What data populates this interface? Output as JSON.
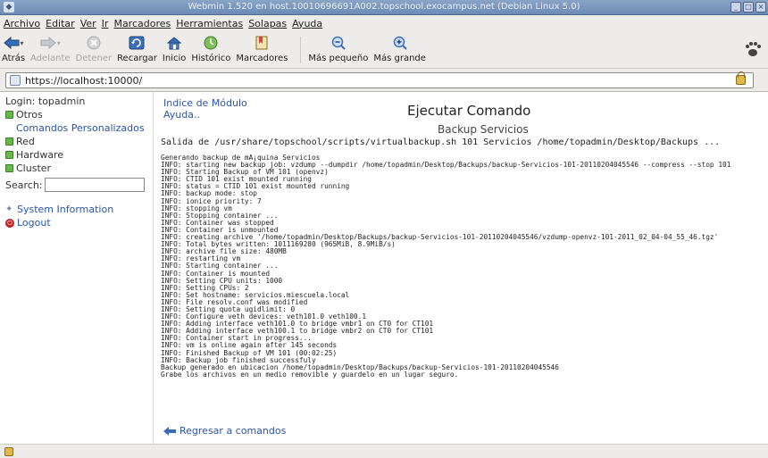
{
  "window": {
    "title": "Webmin 1.520 en host.10010696691A002.topschool.exocampus.net (Debian Linux 5.0)"
  },
  "menubar": {
    "items": [
      "Archivo",
      "Editar",
      "Ver",
      "Ir",
      "Marcadores",
      "Herramientas",
      "Solapas",
      "Ayuda"
    ]
  },
  "toolbar": {
    "back": "Atrás",
    "forward": "Adelante",
    "stop": "Detener",
    "reload": "Recargar",
    "home": "Inicio",
    "history": "Histórico",
    "bookmarks": "Marcadores",
    "zoom_out": "Más pequeño",
    "zoom_in": "Más grande"
  },
  "location": {
    "url": "https://localhost:10000/"
  },
  "sidebar": {
    "login": "Login: topadmin",
    "categories": [
      {
        "label": "Otros",
        "icon": "green-square-icon"
      },
      {
        "label": "Red",
        "icon": "green-square-icon"
      },
      {
        "label": "Hardware",
        "icon": "green-square-icon"
      },
      {
        "label": "Cluster",
        "icon": "green-square-icon"
      }
    ],
    "sublink": "Comandos Personalizados",
    "search_label": "Search:",
    "search_value": "",
    "system_info": "System Information",
    "logout": "Logout"
  },
  "main": {
    "module_index": "Indice de Módulo",
    "help": "Ayuda..",
    "title": "Ejecutar Comando",
    "subtitle": "Backup Servicios",
    "output_header": "Salida de /usr/share/topschool/scripts/virtualbackup.sh 101 Servicios /home/topadmin/Desktop/Backups ...",
    "log_lines": [
      "Generando backup de mÃ¡quina Servicios",
      "INFO: starting new backup job: vzdump --dumpdir /home/topadmin/Desktop/Backups/backup-Servicios-101-20110204045546 --compress --stop 101",
      "INFO: Starting Backup of VM 101 (openvz)",
      "INFO: CTID 101 exist mounted running",
      "INFO: status = CTID 101 exist mounted running",
      "INFO: backup mode: stop",
      "INFO: ionice priority: 7",
      "INFO: stopping vm",
      "INFO: Stopping container ...",
      "INFO: Container was stopped",
      "INFO: Container is unmounted",
      "INFO: creating archive '/home/topadmin/Desktop/Backups/backup-Servicios-101-20110204045546/vzdump-openvz-101-2011_02_04-04_55_46.tgz'",
      "INFO: Total bytes written: 1011169280 (965MiB, 8.9MiB/s)",
      "INFO: archive file size: 480MB",
      "INFO: restarting vm",
      "INFO: Starting container ...",
      "INFO: Container is mounted",
      "INFO: Setting CPU units: 1000",
      "INFO: Setting CPUs: 2",
      "INFO: Set hostname: servicios.miescuela.local",
      "INFO: File resolv.conf was modified",
      "INFO: Setting quota ugidlimit: 0",
      "INFO: Configure veth devices: veth101.0 veth100.1",
      "INFO: Adding interface veth101.0 to bridge vmbr1 on CT0 for CT101",
      "INFO: Adding interface veth100.1 to bridge vmbr2 on CT0 for CT101",
      "INFO: Container start in progress...",
      "INFO: vm is online again after 145 seconds",
      "INFO: Finished Backup of VM 101 (00:02:25)",
      "INFO: Backup job finished successfuly",
      "Backup generado en ubicacion /home/topadmin/Desktop/Backups/backup-Servicios-101-20110204045546",
      "Grabe los archivos en un medio removible y guardelo en un lugar seguro."
    ],
    "return_link": "Regresar a comandos"
  },
  "colors": {
    "link": "#2a55a8",
    "category_icon": "#67b84a",
    "logout_icon": "#c0222a"
  }
}
